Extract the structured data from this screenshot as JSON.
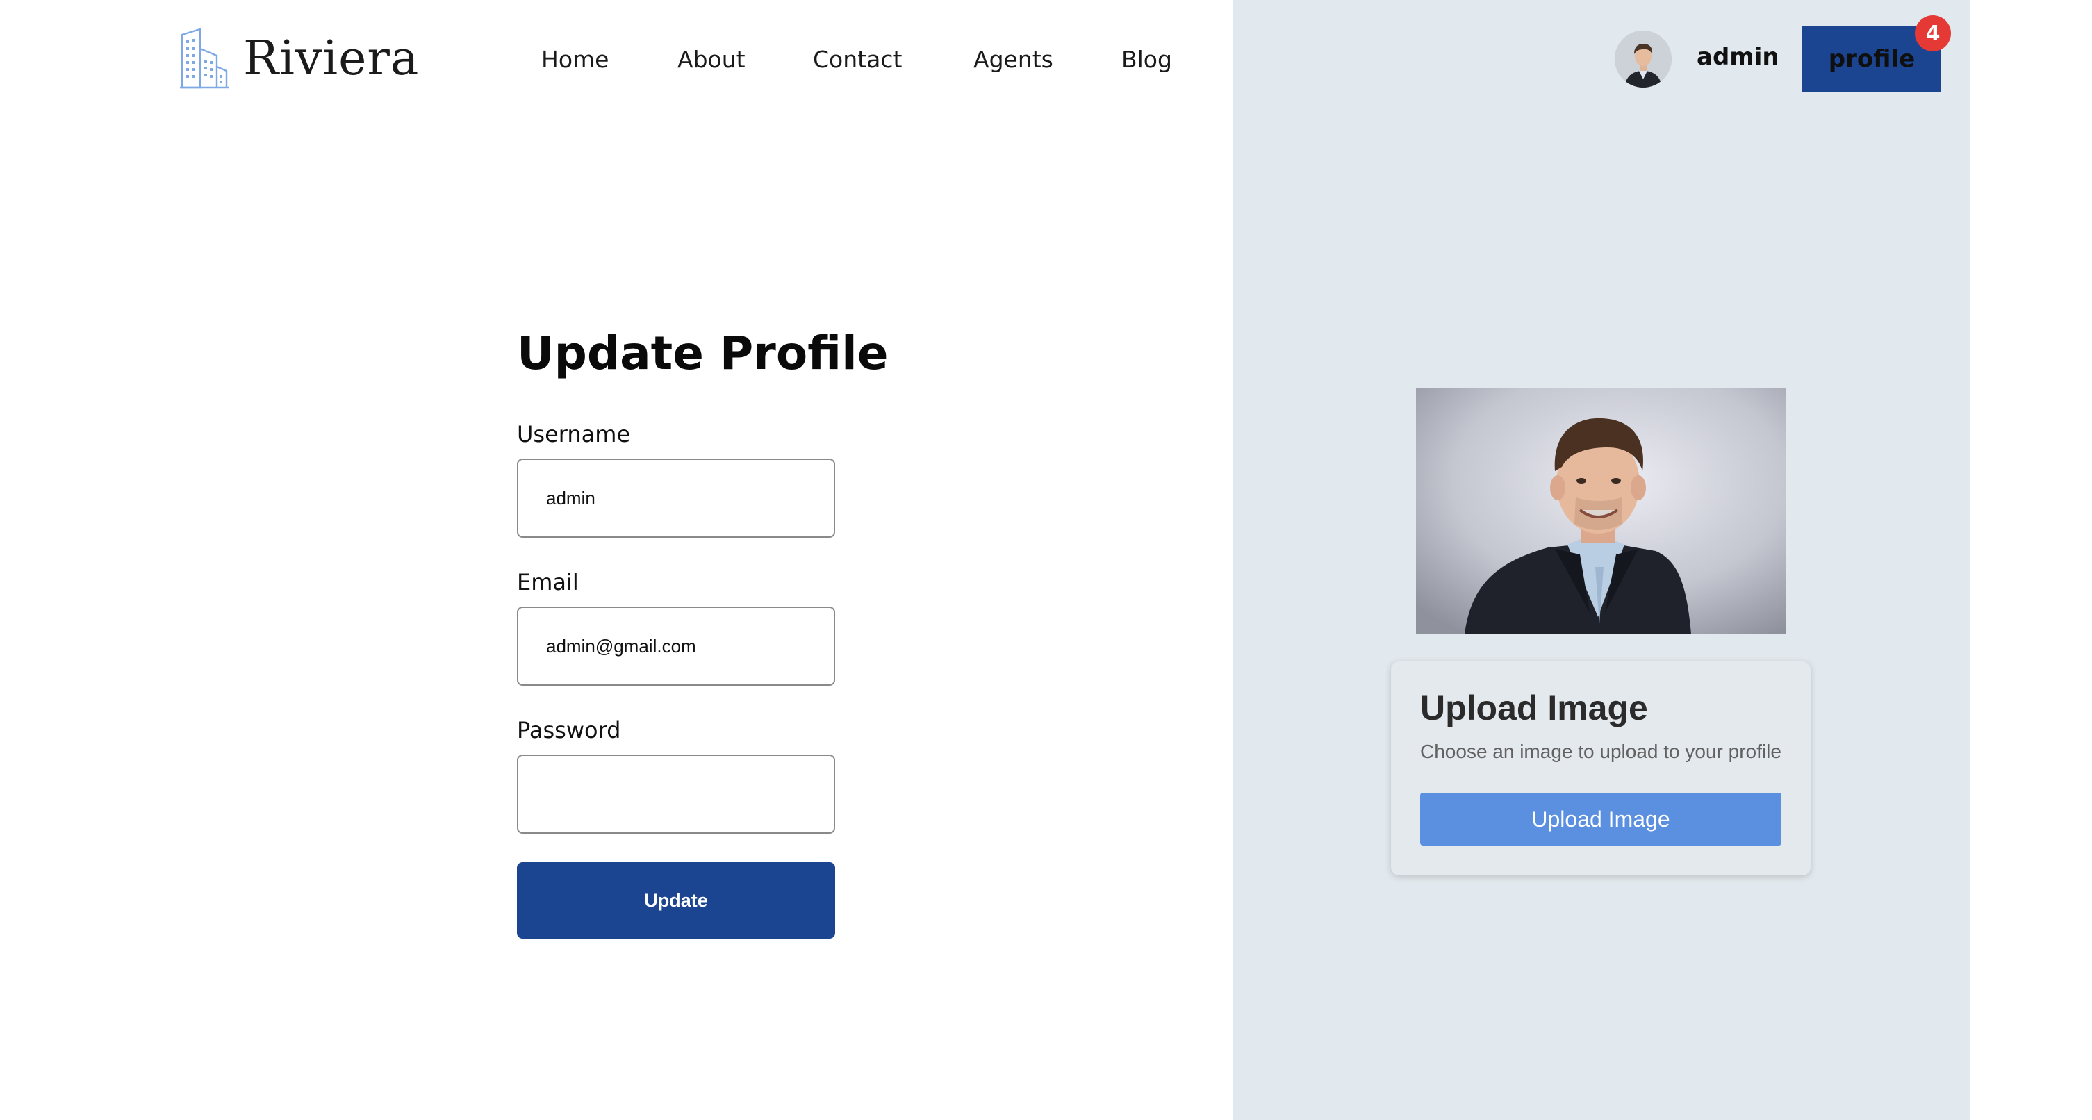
{
  "header": {
    "brand": "Riviera",
    "nav": [
      "Home",
      "About",
      "Contact",
      "Agents",
      "Blog"
    ],
    "user_name": "admin",
    "profile_label": "profile",
    "notification_count": "4",
    "logo_icon": "building-icon"
  },
  "form": {
    "title": "Update Profile",
    "username_label": "Username",
    "username_value": "admin",
    "email_label": "Email",
    "email_value": "admin@gmail.com",
    "password_label": "Password",
    "password_value": "",
    "submit_label": "Update"
  },
  "upload": {
    "title": "Upload Image",
    "description": "Choose an image to upload to your profile",
    "button_label": "Upload Image"
  },
  "colors": {
    "primary": "#1b4590",
    "side_panel": "#e2e9ee",
    "upload_button": "#5b8fe0",
    "badge": "#e53935"
  }
}
